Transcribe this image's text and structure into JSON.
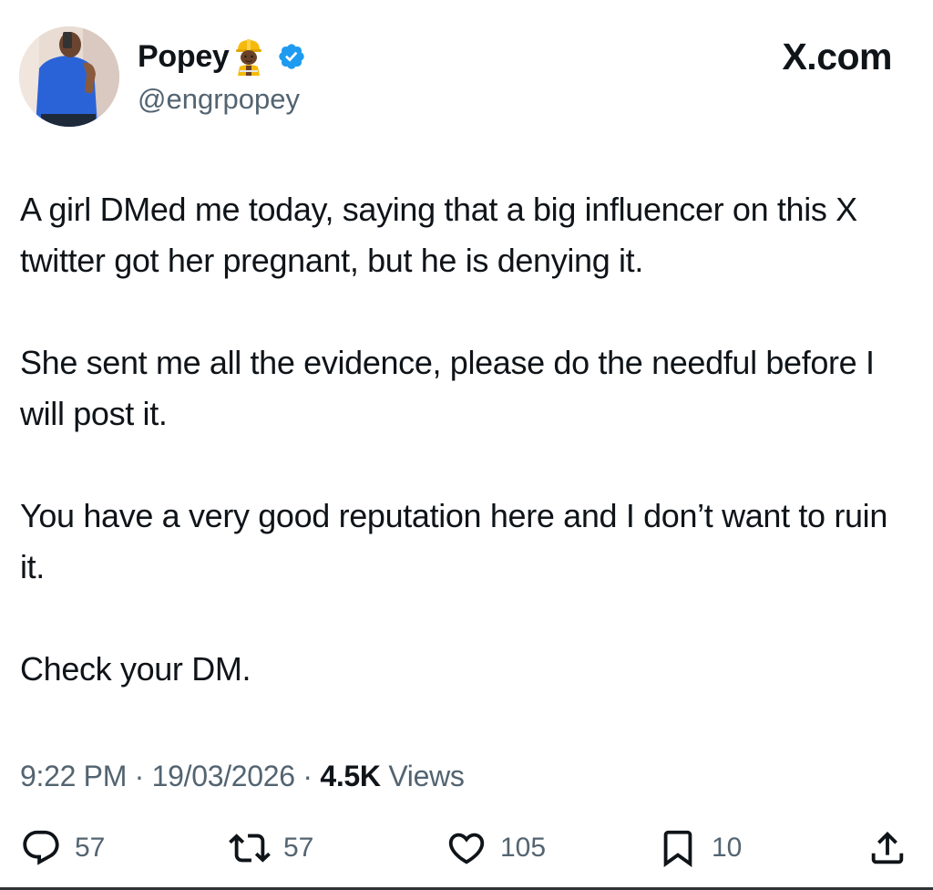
{
  "header": {
    "display_name": "Popey",
    "handle": "@engrpopey",
    "brand": "X.com",
    "icons": {
      "name_emoji": "construction-worker-emoji",
      "verified": "verified-badge-icon",
      "avatar": "profile-photo"
    },
    "colors": {
      "verified_blue": "#1d9bf0"
    }
  },
  "tweet": {
    "paragraphs": [
      "A girl DMed me today, saying that a big influencer on this X twitter got her pregnant, but he is denying it.",
      "She sent me all the evidence, please do the needful before I will post it.",
      "You have a very good reputation here and I don’t want to ruin it.",
      "Check your DM."
    ]
  },
  "meta": {
    "time": "9:22 PM",
    "separator": " · ",
    "date": "19/03/2026",
    "views_count": "4.5K",
    "views_label": " Views"
  },
  "actions": {
    "reply": {
      "icon": "reply-icon",
      "count": "57"
    },
    "repost": {
      "icon": "repost-icon",
      "count": "57"
    },
    "like": {
      "icon": "heart-icon",
      "count": "105"
    },
    "bookmark": {
      "icon": "bookmark-icon",
      "count": "10"
    },
    "share": {
      "icon": "share-icon"
    }
  },
  "colors": {
    "text_primary": "#0f1419",
    "text_secondary": "#536471"
  }
}
